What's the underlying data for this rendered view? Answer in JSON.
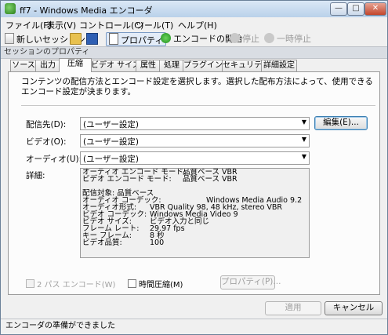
{
  "window": {
    "title": "ff7 - Windows Media エンコーダ"
  },
  "menubar": [
    "ファイル(F)",
    "表示(V)",
    "コントロール(C)",
    "ツール(T)",
    "ヘルプ(H)"
  ],
  "toolbar": {
    "new_session": "新しいセッション",
    "properties": "プロパティ",
    "start_encoding": "エンコードの開始",
    "stop": "停止",
    "pause": "一時停止"
  },
  "section_header": "セッションのプロパティ",
  "tabs": [
    "ソース",
    "出力",
    "圧縮",
    "ビデオ サイズ",
    "属性",
    "処理",
    "プラグイン",
    "セキュリティ",
    "詳細設定"
  ],
  "active_tab": "圧縮",
  "description": "コンテンツの配信方法とエンコード設定を選択します。選択した配布方法によって、使用できるエンコード設定が決まります。",
  "fields": {
    "destination_label": "配信先(D):",
    "destination_value": "(ユーザー設定)",
    "video_label": "ビデオ(O):",
    "video_value": "(ユーザー設定)",
    "audio_label": "オーディオ(U):",
    "audio_value": "(ユーザー設定)",
    "edit_button": "編集(E)..."
  },
  "details": {
    "label": "詳細:",
    "audio_mode_key": "オーディオ エンコード モード:",
    "audio_mode_val": "品質ベース VBR",
    "video_mode_key": "ビデオ エンコード モード:",
    "video_mode_val": "品質ベース VBR",
    "target": "配信対象: 品質ベース",
    "audio_codec_key": "オーディオ コーデック:",
    "audio_codec_val": "Windows Media Audio 9.2",
    "audio_format_key": "オーディオ形式:",
    "audio_format_val": "VBR Quality 98, 48 kHz, stereo VBR",
    "video_codec_key": "ビデオ コーデック:",
    "video_codec_val": "Windows Media Video 9",
    "video_size_key": "ビデオ サイズ:",
    "video_size_val": "ビデオ入力と同じ",
    "frame_rate_key": "フレーム レート:",
    "frame_rate_val": "29.97 fps",
    "keyframe_key": "キー フレーム:",
    "keyframe_val": "8 秒",
    "video_quality_key": "ビデオ品質:",
    "video_quality_val": "100"
  },
  "options": {
    "two_pass": "2 パス エンコード(W)",
    "time_compression": "時間圧縮(M)",
    "properties_button": "プロパティ(P)..."
  },
  "buttons": {
    "apply": "適用",
    "cancel": "キャンセル"
  },
  "status": "エンコーダの準備ができました"
}
